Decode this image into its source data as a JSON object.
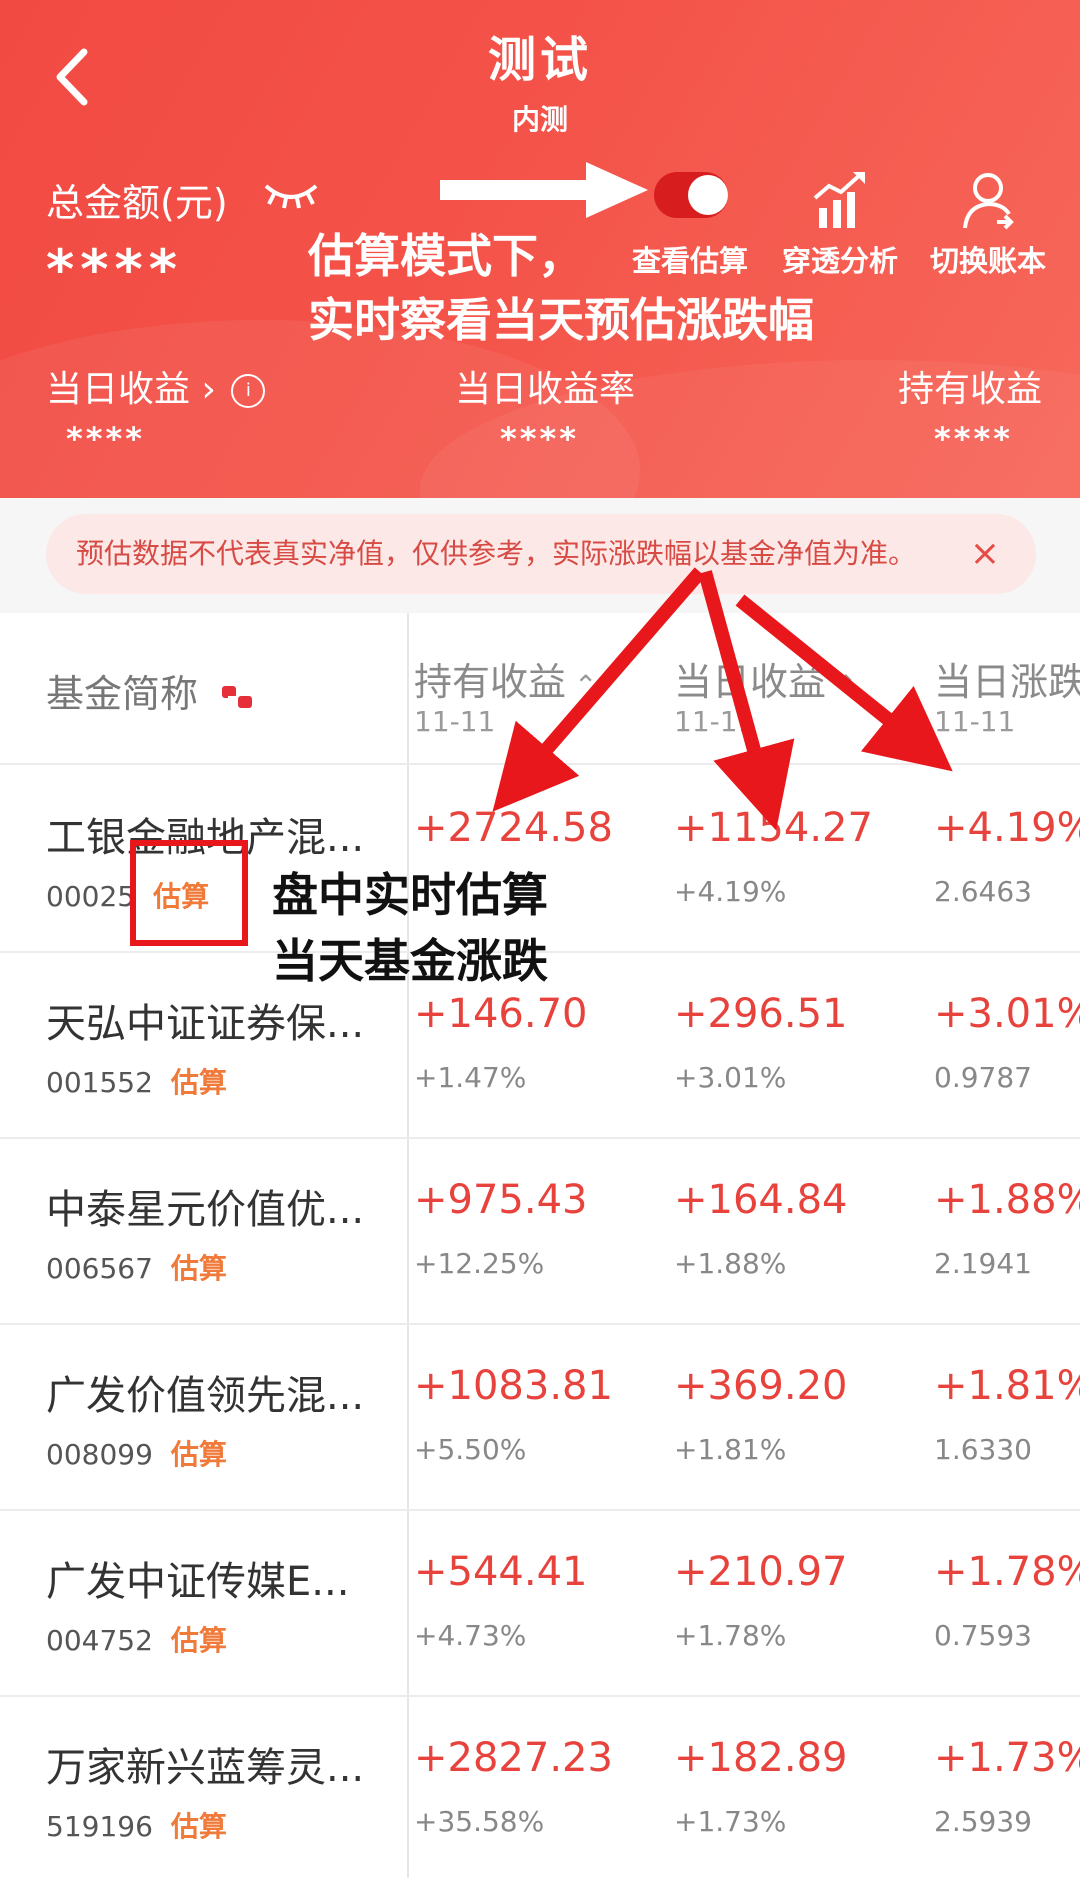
{
  "header": {
    "title": "测试",
    "subtitle": "内测",
    "total_label": "总金额(元)",
    "total_value": "****",
    "tools": [
      {
        "label": "查看估算",
        "icon": "toggle-switch"
      },
      {
        "label": "穿透分析",
        "icon": "bar-chart-icon"
      },
      {
        "label": "切换账本",
        "icon": "user-switch-icon"
      }
    ],
    "stats": [
      {
        "label": "当日收益",
        "value": "****"
      },
      {
        "label": "当日收益率",
        "value": "****"
      },
      {
        "label": "持有收益",
        "value": "****"
      }
    ],
    "info_icon_text": "i"
  },
  "annotations": {
    "toggle_note_line1": "估算模式下，",
    "toggle_note_line2": "实时察看当天预估涨跌幅",
    "row_note_line1": "盘中实时估算",
    "row_note_line2": "当天基金涨跌"
  },
  "notice": {
    "text": "预估数据不代表真实净值，仅供参考，实际涨跌幅以基金净值为准。",
    "close": "×"
  },
  "table": {
    "name_header": "基金简称",
    "columns": [
      {
        "label": "持有收益",
        "date": "11-11"
      },
      {
        "label": "当日收益",
        "date": "11-11"
      },
      {
        "label": "当日涨跌",
        "date": "11-11"
      }
    ],
    "tag": "估算",
    "rows": [
      {
        "name": "工银金融地产混...",
        "code": "00025",
        "hold": "+2724.58",
        "hold_pct": "",
        "daily": "+1154.27",
        "daily_pct": "+4.19%",
        "change": "+4.19%",
        "nav": "2.6463"
      },
      {
        "name": "天弘中证证券保...",
        "code": "001552",
        "hold": "+146.70",
        "hold_pct": "+1.47%",
        "daily": "+296.51",
        "daily_pct": "+3.01%",
        "change": "+3.01%",
        "nav": "0.9787"
      },
      {
        "name": "中泰星元价值优...",
        "code": "006567",
        "hold": "+975.43",
        "hold_pct": "+12.25%",
        "daily": "+164.84",
        "daily_pct": "+1.88%",
        "change": "+1.88%",
        "nav": "2.1941"
      },
      {
        "name": "广发价值领先混...",
        "code": "008099",
        "hold": "+1083.81",
        "hold_pct": "+5.50%",
        "daily": "+369.20",
        "daily_pct": "+1.81%",
        "change": "+1.81%",
        "nav": "1.6330"
      },
      {
        "name": "广发中证传媒E...",
        "code": "004752",
        "hold": "+544.41",
        "hold_pct": "+4.73%",
        "daily": "+210.97",
        "daily_pct": "+1.78%",
        "change": "+1.78%",
        "nav": "0.7593"
      },
      {
        "name": "万家新兴蓝筹灵...",
        "code": "519196",
        "hold": "+2827.23",
        "hold_pct": "+35.58%",
        "daily": "+182.89",
        "daily_pct": "+1.73%",
        "change": "+1.73%",
        "nav": "2.5939"
      }
    ]
  },
  "colors": {
    "header_red": "#f14a43",
    "rise_red": "#e8423c",
    "tag_orange": "#f07a3a",
    "annotation_red": "#e8171b"
  }
}
